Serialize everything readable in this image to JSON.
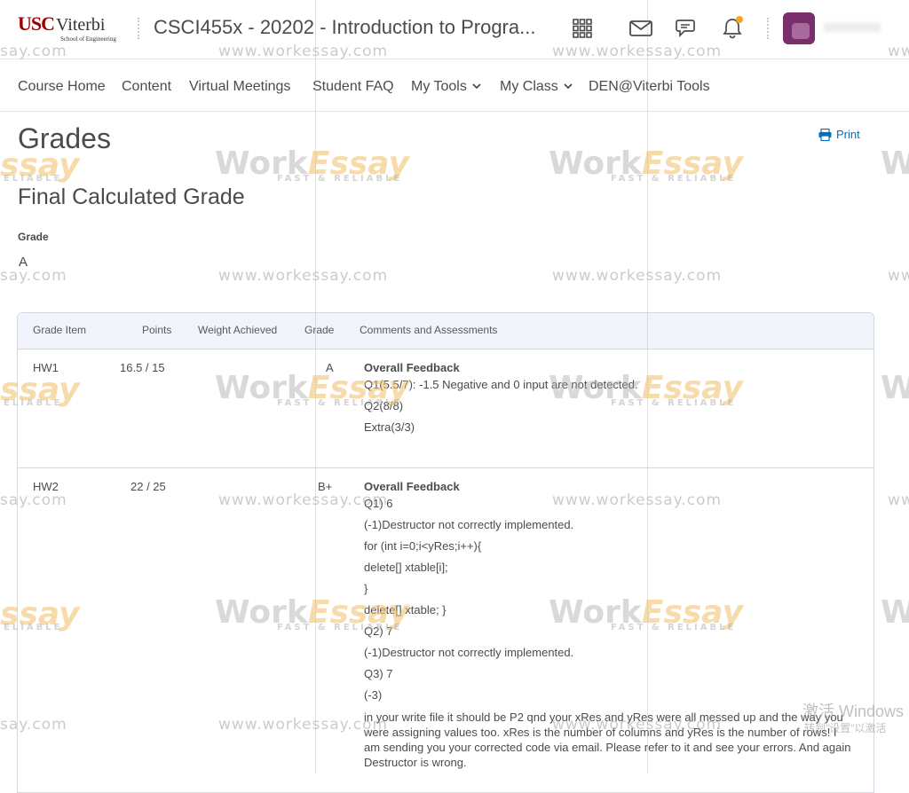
{
  "header": {
    "logo_usc": "USC",
    "logo_viterbi": "Viterbi",
    "logo_sub": "School of Engineering",
    "course_title": "CSCI455x - 20202 - Introduction to Progra...",
    "icons": [
      "apps-grid-icon",
      "mail-icon",
      "chat-icon",
      "bell-icon"
    ],
    "notification_color": "#f5a623"
  },
  "nav": {
    "items": [
      {
        "label": "Course Home"
      },
      {
        "label": "Content"
      },
      {
        "label": "Virtual Meetings"
      },
      {
        "label": "Student FAQ"
      },
      {
        "label": "My Tools"
      },
      {
        "label": "My Class"
      },
      {
        "label": "DEN@Viterbi Tools"
      }
    ]
  },
  "page": {
    "title": "Grades",
    "print_label": "Print",
    "section_title": "Final Calculated Grade",
    "grade_label": "Grade",
    "grade_value": "A"
  },
  "table": {
    "headers": [
      "Grade Item",
      "Points",
      "Weight Achieved",
      "Grade",
      "Comments and Assessments"
    ],
    "rows": [
      {
        "item": "HW1",
        "points": "16.5 / 15",
        "weight": "",
        "grade": "A",
        "feedback_title": "Overall Feedback",
        "lines": [
          "Q1(5.5/7): -1.5 Negative and 0 input are not detected.",
          "Q2(8/8)",
          "Extra(3/3)"
        ]
      },
      {
        "item": "HW2",
        "points": "22 / 25",
        "weight": "",
        "grade": "B+",
        "feedback_title": "Overall Feedback",
        "lines": [
          "Q1) 6",
          "(-1)Destructor not correctly implemented.",
          "for (int i=0;i<yRes;i++){",
          "delete[] xtable[i];",
          "}",
          "delete[] xtable; }",
          "Q2) 7",
          "(-1)Destructor not correctly implemented.",
          "Q3) 7",
          "(-3)"
        ],
        "paragraph": "in your write file it should be P2 qnd your xRes and yRes were all messed up and the way you were assigning values too. xRes is the number of columns and yRes is the number of rows! I am sending you your corrected code via email. Please refer to it and see your errors. And again Destructor is wrong."
      }
    ]
  },
  "watermark": {
    "url": "www.workessay.com",
    "url_partial": "say.com",
    "brand_a": "Work",
    "brand_b": "Essay",
    "brand_partial": "ssay",
    "brand_edge": "W",
    "url_edge": "ww",
    "tagline": "FAST & RELIABLE",
    "tagline_partial": "ELIABLE"
  },
  "windows_activation": {
    "line1": "激活 Windows",
    "line2": "转到\"设置\"以激活"
  },
  "colors": {
    "brand_red": "#990000",
    "link_blue": "#006fbf",
    "avatar": "#7a2e6b",
    "table_header_bg": "#f1f5fb"
  }
}
